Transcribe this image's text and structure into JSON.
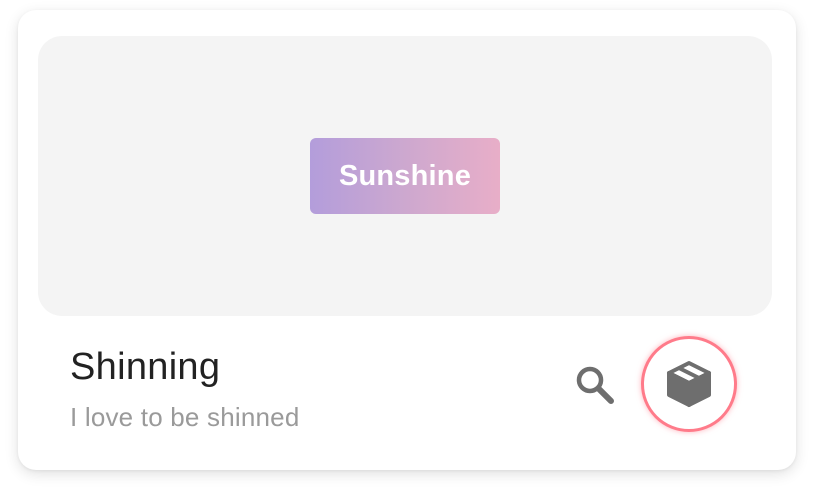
{
  "card": {
    "preview": {
      "button_label": "Sunshine",
      "gradient": [
        "#b39ddb",
        "#e8aec8"
      ],
      "background": "#f4f4f4"
    },
    "title": "Shinning",
    "subtitle": "I love to be shinned",
    "actions": {
      "search_icon": "search-icon",
      "package_icon": "package-icon",
      "highlight_color": "#ff7b8a"
    }
  }
}
